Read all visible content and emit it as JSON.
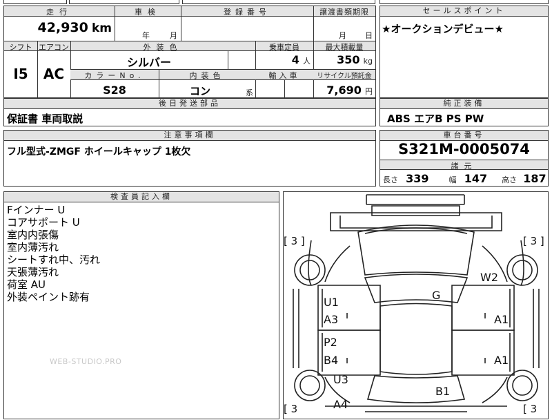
{
  "header": {
    "mileage_label": "走行",
    "inspection_label": "車検",
    "registration_label": "登録番号",
    "transfer_deadline_label": "譲渡書類期限",
    "sales_point_label": "セールスポイント",
    "mileage_value": "42,930",
    "mileage_unit": "km",
    "inspection_year": "年",
    "inspection_month": "月",
    "transfer_month": "月",
    "transfer_day": "日",
    "sales_point_text": "★オークションデビュー★"
  },
  "specs": {
    "shift_label": "シフト",
    "aircon_label": "エアコン",
    "exterior_color_label": "外装色",
    "capacity_label": "乗車定員",
    "max_load_label": "最大積載量",
    "shift_value": "I5",
    "aircon_value": "AC",
    "exterior_color_value": "シルバー",
    "capacity_value": "4",
    "capacity_unit": "人",
    "max_load_value": "350",
    "max_load_unit": "kg",
    "color_no_label": "カラーNo.",
    "interior_color_label": "内装色",
    "import_label": "輸入車",
    "recycle_label": "リサイクル預託金",
    "color_no_value": "S28",
    "interior_color_value": "コン",
    "interior_suffix": "系",
    "recycle_value": "7,690",
    "recycle_unit": "円"
  },
  "later_parts": {
    "label": "後日発送部品",
    "value": "保証書 車両取説"
  },
  "equipment": {
    "label": "純正装備",
    "value": "ABS エアB PS PW"
  },
  "notes": {
    "label": "注意事項欄",
    "value": "フル型式-ZMGF ホイールキャップ 1枚欠"
  },
  "chassis": {
    "label": "車台番号",
    "value": "S321M-0005074",
    "dims_label": "諸元",
    "length_label": "長さ",
    "length_value": "339",
    "width_label": "幅",
    "width_value": "147",
    "height_label": "高さ",
    "height_value": "187"
  },
  "inspector": {
    "label": "検査員記入欄",
    "lines": [
      "Fインナー U",
      "コアサポート U",
      "室内内張傷",
      "室内薄汚れ",
      "シートすれ中、汚れ",
      "天張薄汚れ",
      "荷室 AU",
      "外装ペイント跡有"
    ],
    "watermark": "WEB-STUDIO.PRO"
  },
  "diagram": {
    "tire_tl": "[ 3 ]",
    "tire_tr": "[ 3 ]",
    "tire_bl": "[ 3",
    "tire_br": "[ 3",
    "marks": {
      "w2": "W2",
      "g": "G",
      "u1": "U1",
      "a3": "A3",
      "a1_top": "A1",
      "p2": "P2",
      "b4": "B4",
      "a1_mid": "A1",
      "u3": "U3",
      "b1": "B1",
      "a4": "A4"
    }
  }
}
